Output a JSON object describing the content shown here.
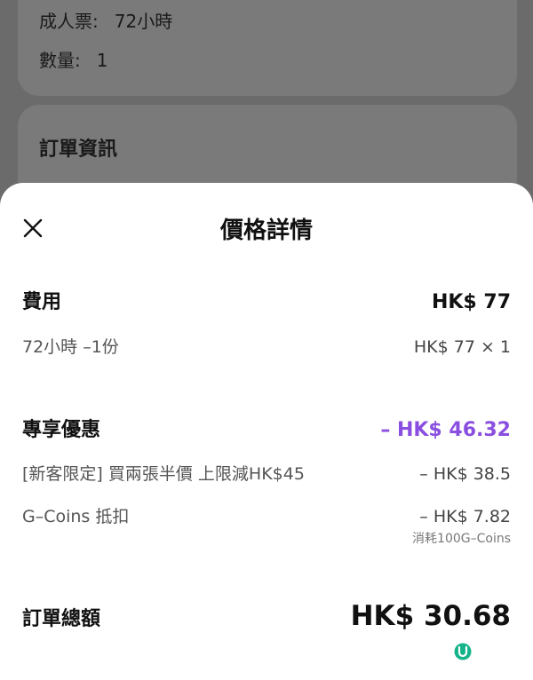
{
  "background": {
    "ticket_label": "成人票:",
    "ticket_value": "72小時",
    "quantity_label": "數量:",
    "quantity_value": "1",
    "order_info_title": "訂單資訊"
  },
  "sheet": {
    "title": "價格詳情",
    "close_icon": "close-icon",
    "fee": {
      "label": "費用",
      "amount": "HK$ 77",
      "item_label": "72小時 –1份",
      "item_value": "HK$ 77 × 1"
    },
    "discount": {
      "label": "專享優惠",
      "amount": "– HK$ 46.32",
      "accent_color": "#8a4fe0",
      "items": [
        {
          "label": "[新客限定] 買兩張半價 上限減HK$45",
          "value": "– HK$ 38.5"
        },
        {
          "label": "G–Coins 抵扣",
          "value": "– HK$ 7.82",
          "note": "消耗100G–Coins"
        }
      ]
    },
    "total": {
      "label": "訂單總額",
      "amount": "HK$ 30.68"
    }
  }
}
